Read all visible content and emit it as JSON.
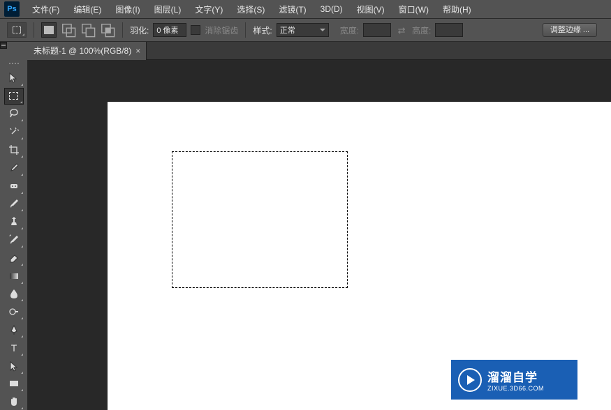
{
  "app": {
    "logo": "Ps"
  },
  "menu": [
    "文件(F)",
    "编辑(E)",
    "图像(I)",
    "图层(L)",
    "文字(Y)",
    "选择(S)",
    "滤镜(T)",
    "3D(D)",
    "视图(V)",
    "窗口(W)",
    "帮助(H)"
  ],
  "options": {
    "feather_label": "羽化:",
    "feather_value": "0 像素",
    "antialias_label": "消除锯齿",
    "style_label": "样式:",
    "style_value": "正常",
    "width_label": "宽度:",
    "height_label": "高度:",
    "refine_label": "调整边缘 ..."
  },
  "tab": {
    "title": "未标题-1 @ 100%(RGB/8)",
    "close": "×"
  },
  "watermark": {
    "main": "溜溜自学",
    "sub": "ZIXUE.3D66.COM"
  },
  "tools": [
    "move-tool",
    "marquee-tool",
    "lasso-tool",
    "magic-wand-tool",
    "crop-tool",
    "eyedropper-tool",
    "spot-heal-tool",
    "brush-tool",
    "clone-stamp-tool",
    "history-brush-tool",
    "eraser-tool",
    "gradient-tool",
    "blur-tool",
    "dodge-tool",
    "pen-tool",
    "type-tool",
    "path-select-tool",
    "rectangle-tool",
    "hand-tool"
  ]
}
